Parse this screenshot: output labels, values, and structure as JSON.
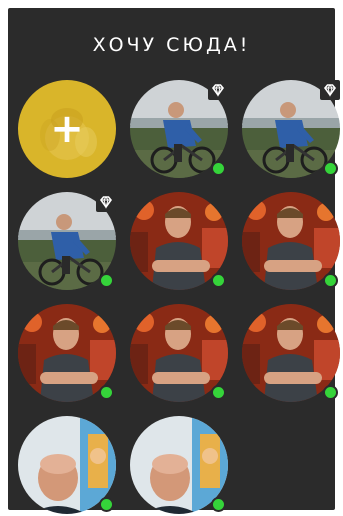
{
  "widget": {
    "title": "ХОЧУ СЮДА!",
    "add_label": "+"
  },
  "colors": {
    "panel": "#2b2b2b",
    "online": "#35d43a",
    "add_bg": "#d9b52a"
  },
  "avatars": [
    {
      "photo": "cyclist",
      "vip": true,
      "online": true
    },
    {
      "photo": "cyclist",
      "vip": true,
      "online": true
    },
    {
      "photo": "cyclist",
      "vip": true,
      "online": true
    },
    {
      "photo": "man-red-bg",
      "vip": false,
      "online": true
    },
    {
      "photo": "man-red-bg",
      "vip": false,
      "online": true
    },
    {
      "photo": "man-red-bg",
      "vip": false,
      "online": true
    },
    {
      "photo": "man-red-bg",
      "vip": false,
      "online": true
    },
    {
      "photo": "man-red-bg",
      "vip": false,
      "online": true
    },
    {
      "photo": "bald-man",
      "vip": false,
      "online": true
    },
    {
      "photo": "bald-man",
      "vip": false,
      "online": true
    }
  ]
}
